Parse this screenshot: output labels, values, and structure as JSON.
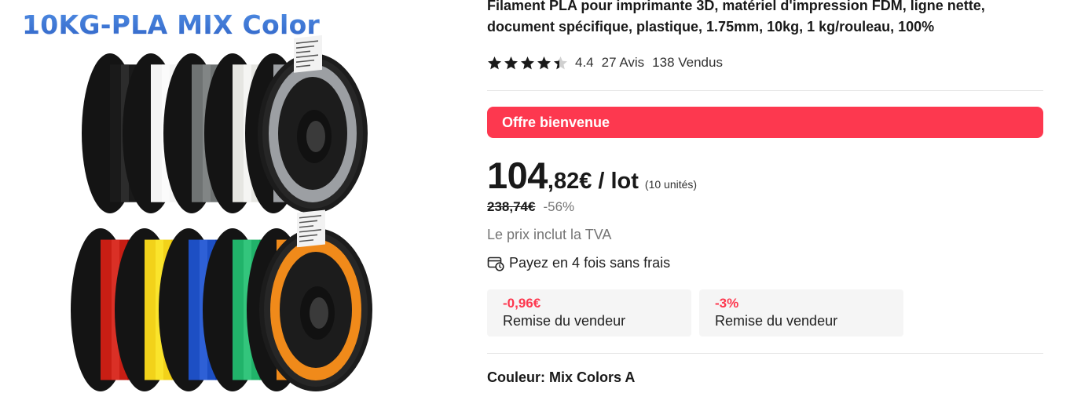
{
  "image": {
    "overlay_title": "10KG-PLA MIX Color",
    "title_color": "#3a73d6",
    "spool_colors_top": [
      "#1a1a1a",
      "#f4f4f4",
      "#6f7373",
      "#e6e6e2",
      "#9c9fa3"
    ],
    "spool_colors_bottom": [
      "#c81e14",
      "#f2d21a",
      "#1d4fc4",
      "#21b36a",
      "#f08a1a"
    ],
    "spool_label_text": "LTEMON PLA 3D FILAMENT"
  },
  "product": {
    "title": "Filament PLA pour imprimante 3D, matériel d'impression FDM, ligne nette, document spécifique, plastique, 1.75mm, 10kg, 1 kg/rouleau, 100%",
    "rating": {
      "stars": 4.4,
      "value_text": "4.4",
      "reviews_text": "27 Avis",
      "sold_text": "138 Vendus"
    },
    "welcome_banner": "Offre bienvenue",
    "price": {
      "integer": "104",
      "decimal": ",82€",
      "unit": "/ lot",
      "quantity": "(10 unités)"
    },
    "old_price": "238,74€",
    "discount": "-56%",
    "vat_note": "Le prix inclut la TVA",
    "installment": "Payez en 4 fois sans frais",
    "coupons": [
      {
        "amount": "-0,96€",
        "label": "Remise du vendeur"
      },
      {
        "amount": "-3%",
        "label": "Remise du vendeur"
      }
    ],
    "color_label": "Couleur: Mix Colors A"
  },
  "colors": {
    "accent_red": "#fd384f",
    "text_dark": "#191919",
    "text_muted": "#757575",
    "coupon_bg": "#f5f5f5"
  },
  "icons": {
    "star": "star-icon",
    "installment": "card-clock-icon"
  }
}
